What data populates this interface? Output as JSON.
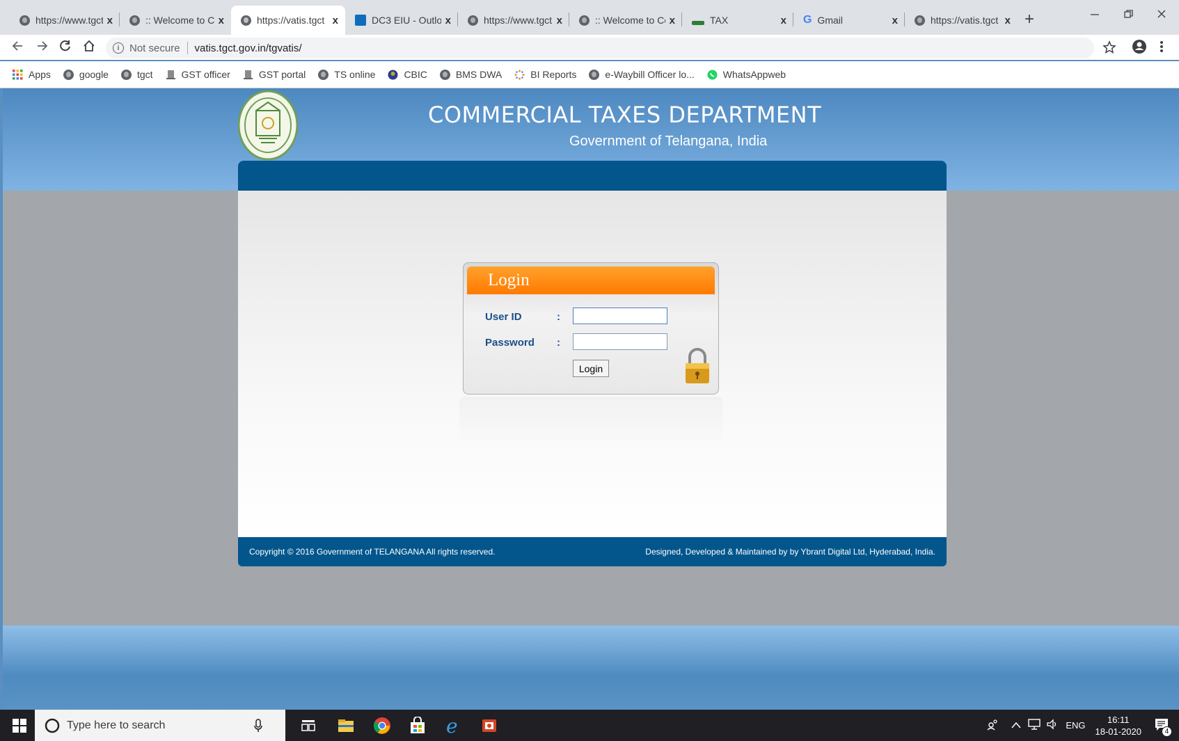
{
  "browser": {
    "tabs": [
      {
        "title": "https://www.tgct",
        "icon": "globe-icon"
      },
      {
        "title": ":: Welcome to Co",
        "icon": "globe-icon"
      },
      {
        "title": "https://vatis.tgct",
        "icon": "globe-icon",
        "active": true
      },
      {
        "title": "DC3 EIU - Outlo",
        "icon": "outlook-icon"
      },
      {
        "title": "https://www.tgct",
        "icon": "globe-icon"
      },
      {
        "title": ":: Welcome to Co",
        "icon": "globe-icon"
      },
      {
        "title": "TAX",
        "icon": "green-bar-icon"
      },
      {
        "title": "Gmail",
        "icon": "google-g-icon"
      },
      {
        "title": "https://vatis.tgct",
        "icon": "globe-icon"
      }
    ],
    "close_glyph": "x",
    "new_tab_glyph": "+",
    "address": {
      "security": "Not secure",
      "url": "vatis.tgct.gov.in/tgvatis/"
    },
    "bookmarks": [
      {
        "label": "Apps",
        "icon": "apps-grid-icon"
      },
      {
        "label": "google",
        "icon": "globe-icon"
      },
      {
        "label": "tgct",
        "icon": "globe-icon"
      },
      {
        "label": "GST officer",
        "icon": "emblem-icon"
      },
      {
        "label": "GST portal",
        "icon": "emblem-icon"
      },
      {
        "label": "TS online",
        "icon": "globe-icon"
      },
      {
        "label": "CBIC",
        "icon": "cbic-icon"
      },
      {
        "label": "BMS DWA",
        "icon": "globe-icon"
      },
      {
        "label": "BI Reports",
        "icon": "dots-icon"
      },
      {
        "label": "e-Waybill Officer lo...",
        "icon": "globe-icon"
      },
      {
        "label": "WhatsAppweb",
        "icon": "whatsapp-icon"
      }
    ]
  },
  "site": {
    "title": "COMMERCIAL TAXES DEPARTMENT",
    "subtitle": "Government of Telangana, India",
    "login": {
      "heading": "Login",
      "userid_label": "User ID",
      "password_label": "Password",
      "colon": ":",
      "userid_value": "",
      "password_value": "",
      "button_label": "Login"
    },
    "footer": {
      "copyright": "Copyright © 2016 Government of TELANGANA All rights reserved.",
      "credit": "Designed, Developed & Maintained by by Ybrant Digital Ltd, Hyderabad, India."
    }
  },
  "taskbar": {
    "search_placeholder": "Type here to search",
    "language": "ENG",
    "time": "16:11",
    "date": "18-01-2020",
    "notification_count": "4"
  },
  "colors": {
    "header_blue": "#02568c",
    "login_orange": "#ff8a10",
    "label_blue": "#1b4f8a"
  }
}
